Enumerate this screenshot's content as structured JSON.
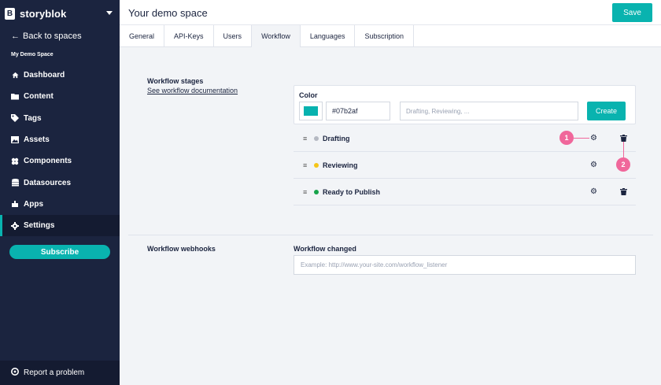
{
  "brand": {
    "name": "storyblok",
    "logo_letter": "B"
  },
  "sidebar": {
    "back_label": "Back to spaces",
    "space_name": "My Demo Space",
    "items": [
      {
        "label": "Dashboard",
        "icon": "home-icon"
      },
      {
        "label": "Content",
        "icon": "folder-icon"
      },
      {
        "label": "Tags",
        "icon": "tag-icon"
      },
      {
        "label": "Assets",
        "icon": "image-icon"
      },
      {
        "label": "Components",
        "icon": "components-icon"
      },
      {
        "label": "Datasources",
        "icon": "database-icon"
      },
      {
        "label": "Apps",
        "icon": "apps-icon"
      },
      {
        "label": "Settings",
        "icon": "gear-icon",
        "active": true
      }
    ],
    "subscribe_label": "Subscribe",
    "report_label": "Report a problem"
  },
  "header": {
    "title": "Your demo space",
    "save_label": "Save"
  },
  "tabs": [
    "General",
    "API-Keys",
    "Users",
    "Workflow",
    "Languages",
    "Subscription"
  ],
  "active_tab": "Workflow",
  "workflow": {
    "title": "Workflow stages",
    "doc_link": "See workflow documentation",
    "color_label": "Color",
    "color_value": "#07b2af",
    "name_placeholder": "Drafting, Reviewing, ...",
    "create_label": "Create",
    "stages": [
      {
        "name": "Drafting",
        "color": "#b5b9c2",
        "deletable": true
      },
      {
        "name": "Reviewing",
        "color": "#f5c518",
        "deletable": false
      },
      {
        "name": "Ready to Publish",
        "color": "#16a34a",
        "deletable": true
      }
    ]
  },
  "markers": [
    "1",
    "2"
  ],
  "webhooks": {
    "title": "Workflow webhooks",
    "label": "Workflow changed",
    "placeholder": "Example: http://www.your-site.com/workflow_listener"
  },
  "colors": {
    "accent": "#09b3af",
    "sidebar_bg": "#1b243f",
    "marker": "#f0679b"
  }
}
